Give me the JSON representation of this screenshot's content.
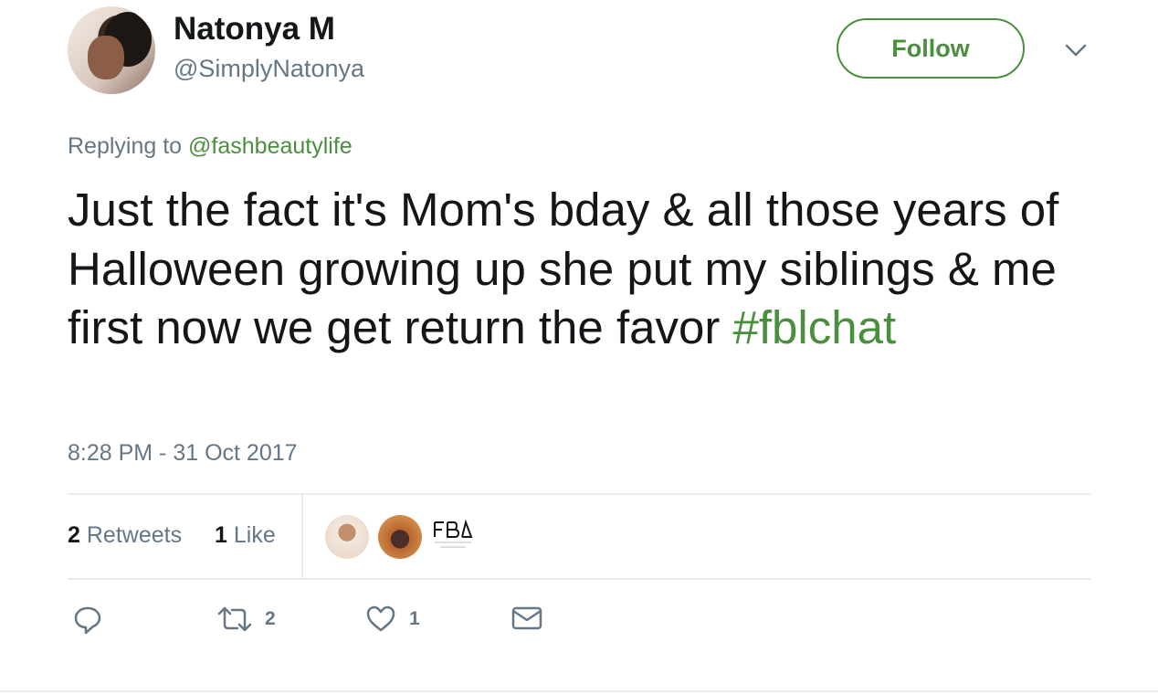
{
  "user": {
    "name": "Natonya M",
    "handle": "@SimplyNatonya"
  },
  "follow_label": "Follow",
  "replying": {
    "prefix": "Replying to",
    "mention": "@fashbeautylife"
  },
  "tweet": {
    "text": "Just the fact it's Mom's bday & all those years of Halloween growing up she put my siblings & me first now we get return the favor",
    "hashtag": "#fblchat"
  },
  "timestamp": "8:28 PM - 31 Oct 2017",
  "stats": {
    "retweets_count": "2",
    "retweets_label": "Retweets",
    "likes_count": "1",
    "likes_label": "Like"
  },
  "actions": {
    "retweet_count": "2",
    "like_count": "1"
  },
  "colors": {
    "accent": "#4a8f3e",
    "secondary_text": "#657786",
    "primary_text": "#14171a",
    "divider": "#e6ecf0"
  },
  "icons": [
    "chevron-down-icon",
    "reply-icon",
    "retweet-icon",
    "heart-icon",
    "mail-icon"
  ]
}
